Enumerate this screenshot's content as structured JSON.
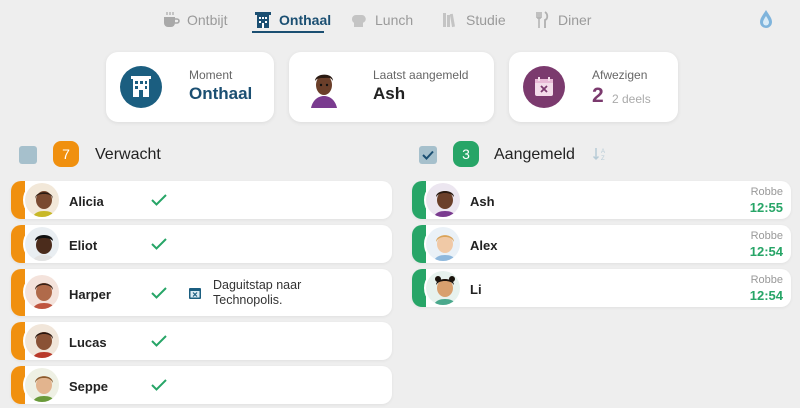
{
  "nav": {
    "tabs": [
      {
        "label": "Ontbijt",
        "icon": "coffee-cup-icon",
        "active": false
      },
      {
        "label": "Onthaal",
        "icon": "building-icon",
        "active": true
      },
      {
        "label": "Lunch",
        "icon": "bread-icon",
        "active": false
      },
      {
        "label": "Studie",
        "icon": "books-icon",
        "active": false
      },
      {
        "label": "Diner",
        "icon": "cutlery-icon",
        "active": false
      }
    ],
    "drop_icon": "water-drop-icon"
  },
  "cards": {
    "moment": {
      "label": "Moment",
      "value": "Onthaal",
      "icon": "building-icon",
      "color": "#1b5e80"
    },
    "last": {
      "label": "Laatst aangemeld",
      "value": "Ash",
      "icon": "avatar"
    },
    "absent": {
      "label": "Afwezigen",
      "value": "2",
      "sub": "2 deels",
      "icon": "calendar-x-icon",
      "color": "#7b3a6e"
    }
  },
  "expected": {
    "count": "7",
    "title": "Verwacht",
    "badge_color": "#f0900f",
    "rows": [
      {
        "name": "Alicia",
        "note": ""
      },
      {
        "name": "Eliot",
        "note": ""
      },
      {
        "name": "Harper",
        "note": "Daguitstap naar Technopolis."
      },
      {
        "name": "Lucas",
        "note": ""
      },
      {
        "name": "Seppe",
        "note": ""
      }
    ]
  },
  "registered": {
    "count": "3",
    "title": "Aangemeld",
    "badge_color": "#27a567",
    "sort_icon": "sort-az-icon",
    "rows": [
      {
        "name": "Ash",
        "by": "Robbe",
        "time": "12:55"
      },
      {
        "name": "Alex",
        "by": "Robbe",
        "time": "12:54"
      },
      {
        "name": "Li",
        "by": "Robbe",
        "time": "12:54"
      }
    ]
  }
}
